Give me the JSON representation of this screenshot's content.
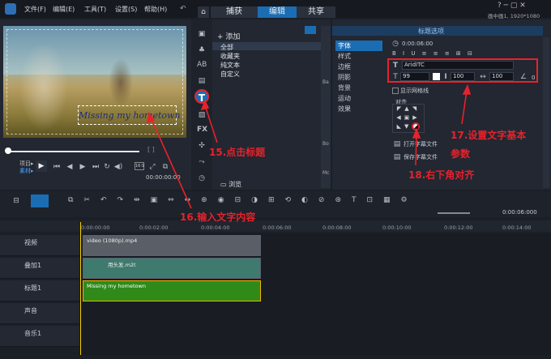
{
  "menu": {
    "items": [
      "文件(F)",
      "编辑(E)",
      "工具(T)",
      "设置(S)",
      "帮助(H)"
    ]
  },
  "tabs": {
    "capture": "捕获",
    "edit": "编辑",
    "share": "共享"
  },
  "status": {
    "resolution": "画中画1, 1920*1080"
  },
  "preview": {
    "overlay_text": "Missing my hometown",
    "labels": {
      "project": "项目▸",
      "material": "素材▸"
    },
    "timecode": "00:00:00:00",
    "ratio": "16:9"
  },
  "library": {
    "add": "添加",
    "items": [
      "全部",
      "收藏夹",
      "纯文本",
      "自定义"
    ],
    "browse": "浏览"
  },
  "options": {
    "header": "标题选项",
    "side_tabs": [
      "字体",
      "样式",
      "边框",
      "阴影",
      "背景",
      "运动",
      "效果"
    ],
    "duration": "0:00:06:00",
    "font": "AridITC",
    "size": "99",
    "line_spacing": "100",
    "letter_spacing": "100",
    "angle": "0",
    "grid": "显示网格线",
    "align_label": "对齐",
    "open_subtitle": "打开字幕文件",
    "save_subtitle": "保存字幕文件"
  },
  "annotations": {
    "step15": "15.点击标题",
    "step16": "16.输入文字内容",
    "step17a": "17.设置文字基本",
    "step17b": "参数",
    "step18": "18.右下角对齐"
  },
  "timeline": {
    "duration": "0:00:06:000",
    "ruler": [
      "0:00:00:00",
      "0:00:02:00",
      "0:00:04:00",
      "0:00:06:00",
      "0:00:08:00",
      "0:00:10:00",
      "0:00:12:00",
      "0:00:14:00"
    ],
    "tracks": [
      "视频",
      "叠加1",
      "标题1",
      "声音",
      "音乐1"
    ],
    "clips": {
      "video": "video (1080p).mp4",
      "overlay": "用头发.m2t",
      "title": "Missing my hometown"
    }
  },
  "colors": {
    "accent": "#1b6db3",
    "annotation": "#e8222b",
    "title_clip": "#2f8a1a"
  }
}
